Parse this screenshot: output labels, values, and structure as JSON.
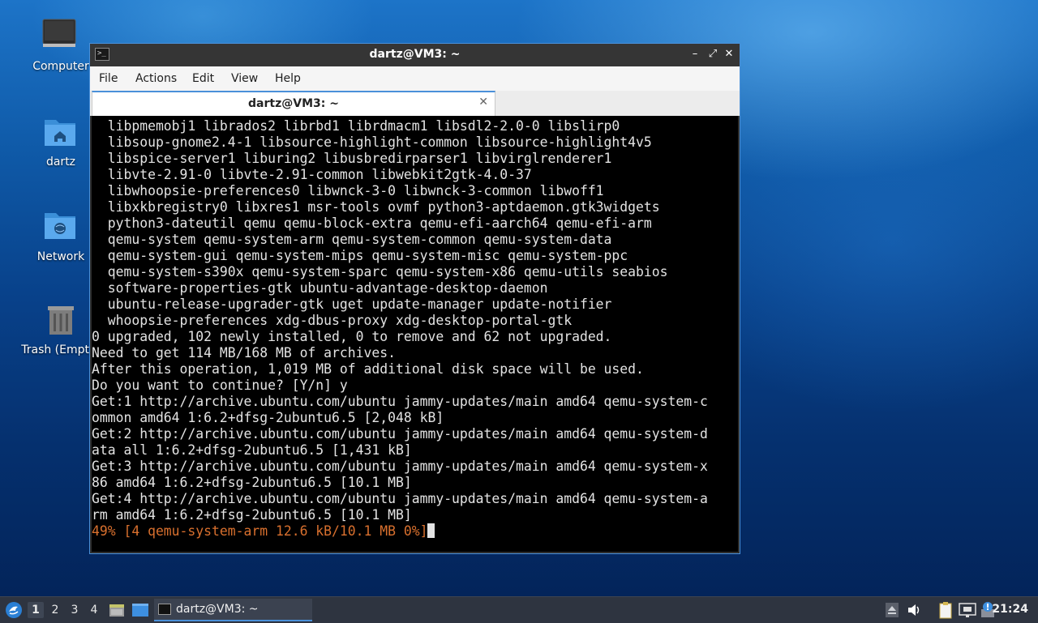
{
  "desktop": {
    "icons": [
      {
        "label": "Computer",
        "icon": "computer-icon"
      },
      {
        "label": "dartz",
        "icon": "home-folder-icon"
      },
      {
        "label": "Network",
        "icon": "network-folder-icon"
      },
      {
        "label": "Trash (Empty)",
        "icon": "trash-icon"
      }
    ]
  },
  "window": {
    "title": "dartz@VM3: ~",
    "controls": {
      "minimize": "–",
      "maximize": "⤢",
      "close": "✕"
    },
    "menu": [
      "File",
      "Actions",
      "Edit",
      "View",
      "Help"
    ],
    "tab": {
      "label": "dartz@VM3: ~",
      "close": "✕"
    }
  },
  "terminal": {
    "lines": [
      "  libpmemobj1 librados2 librbd1 librdmacm1 libsdl2-2.0-0 libslirp0",
      "  libsoup-gnome2.4-1 libsource-highlight-common libsource-highlight4v5",
      "  libspice-server1 liburing2 libusbredirparser1 libvirglrenderer1",
      "  libvte-2.91-0 libvte-2.91-common libwebkit2gtk-4.0-37",
      "  libwhoopsie-preferences0 libwnck-3-0 libwnck-3-common libwoff1",
      "  libxkbregistry0 libxres1 msr-tools ovmf python3-aptdaemon.gtk3widgets",
      "  python3-dateutil qemu qemu-block-extra qemu-efi-aarch64 qemu-efi-arm",
      "  qemu-system qemu-system-arm qemu-system-common qemu-system-data",
      "  qemu-system-gui qemu-system-mips qemu-system-misc qemu-system-ppc",
      "  qemu-system-s390x qemu-system-sparc qemu-system-x86 qemu-utils seabios",
      "  software-properties-gtk ubuntu-advantage-desktop-daemon",
      "  ubuntu-release-upgrader-gtk uget update-manager update-notifier",
      "  whoopsie-preferences xdg-dbus-proxy xdg-desktop-portal-gtk",
      "0 upgraded, 102 newly installed, 0 to remove and 62 not upgraded.",
      "Need to get 114 MB/168 MB of archives.",
      "After this operation, 1,019 MB of additional disk space will be used.",
      "Do you want to continue? [Y/n] y",
      "Get:1 http://archive.ubuntu.com/ubuntu jammy-updates/main amd64 qemu-system-c",
      "ommon amd64 1:6.2+dfsg-2ubuntu6.5 [2,048 kB]",
      "Get:2 http://archive.ubuntu.com/ubuntu jammy-updates/main amd64 qemu-system-d",
      "ata all 1:6.2+dfsg-2ubuntu6.5 [1,431 kB]",
      "Get:3 http://archive.ubuntu.com/ubuntu jammy-updates/main amd64 qemu-system-x",
      "86 amd64 1:6.2+dfsg-2ubuntu6.5 [10.1 MB]",
      "Get:4 http://archive.ubuntu.com/ubuntu jammy-updates/main amd64 qemu-system-a",
      "rm amd64 1:6.2+dfsg-2ubuntu6.5 [10.1 MB]"
    ],
    "progress_line": "49% [4 qemu-system-arm 12.6 kB/10.1 MB 0%]",
    "colors": {
      "background": "#000000",
      "text": "#e3e3e3",
      "progress": "#d9702e"
    }
  },
  "taskbar": {
    "menu_icon": "lxqt-logo-icon",
    "workspaces": [
      "1",
      "2",
      "3",
      "4"
    ],
    "active_workspace": "1",
    "quicklaunch": [
      {
        "icon": "file-manager-icon"
      },
      {
        "icon": "show-desktop-icon"
      }
    ],
    "task": {
      "label": "dartz@VM3: ~",
      "icon": "terminal-icon"
    },
    "tray": [
      {
        "icon": "eject-icon"
      },
      {
        "icon": "volume-icon"
      },
      {
        "icon": "clipboard-icon"
      },
      {
        "icon": "network-icon"
      },
      {
        "icon": "update-notifier-icon"
      }
    ],
    "clock": "21:24"
  }
}
